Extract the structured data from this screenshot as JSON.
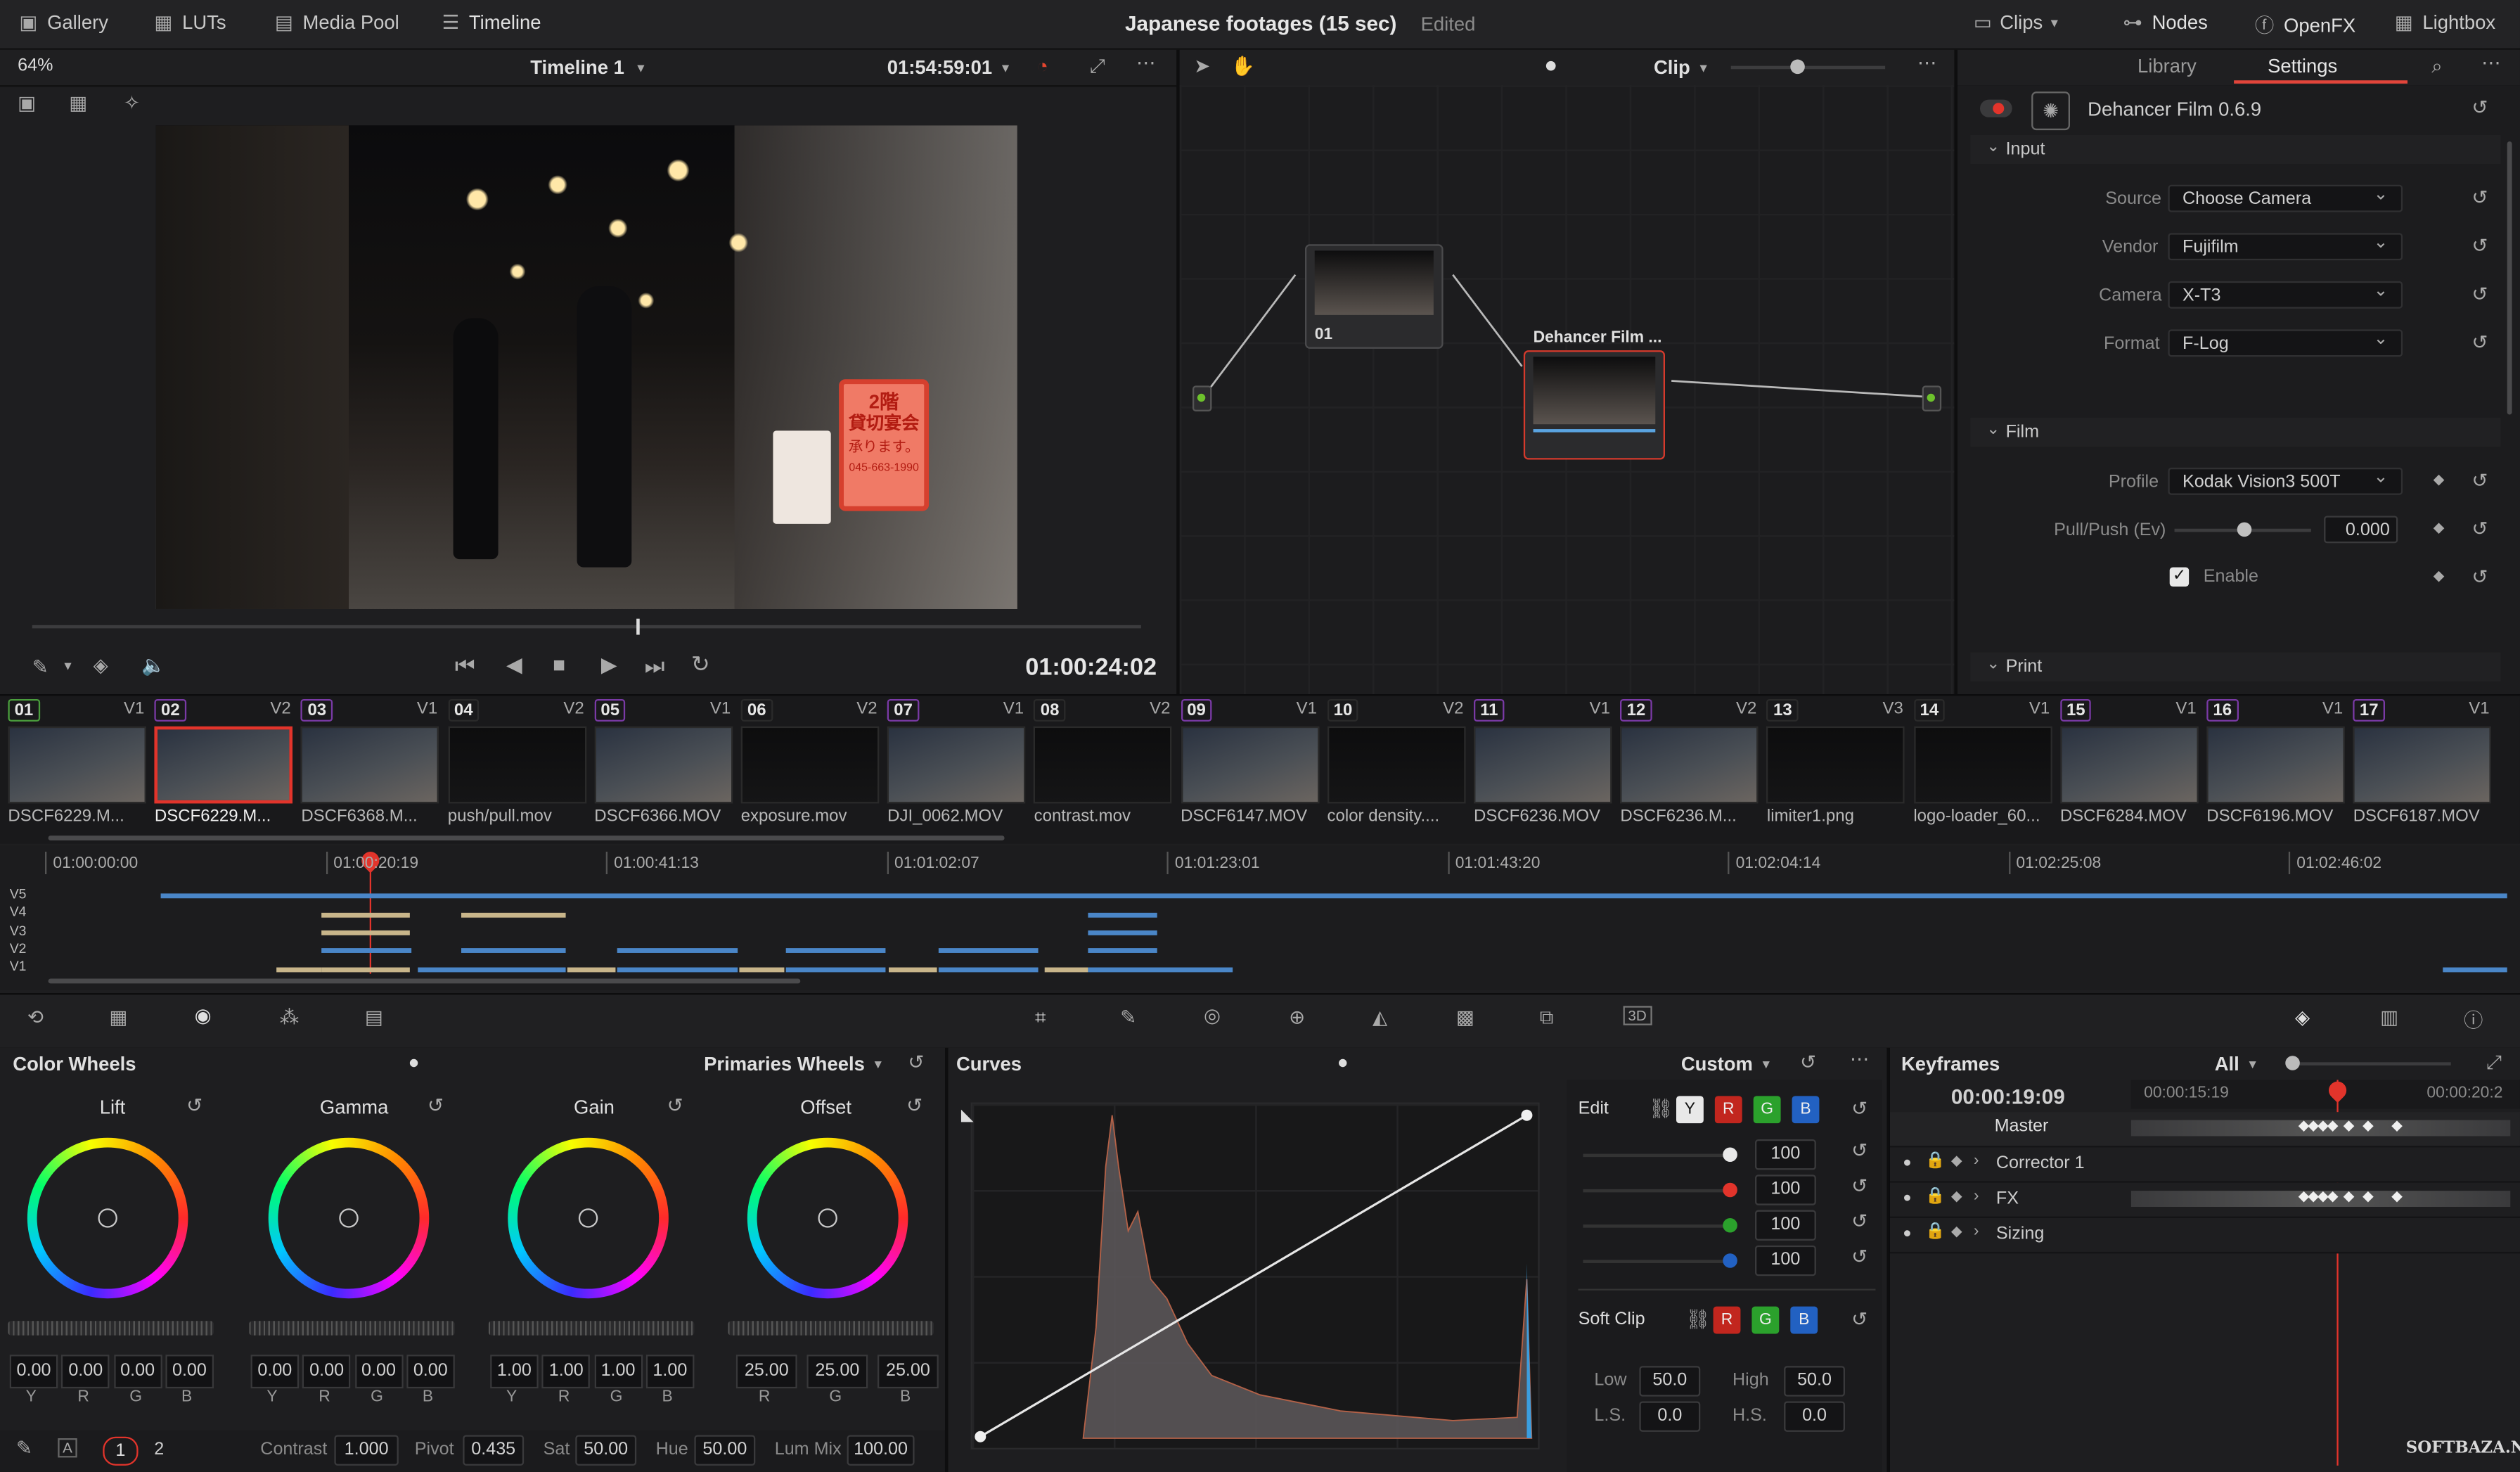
{
  "topbar": {
    "gallery": "Gallery",
    "luts": "LUTs",
    "media_pool": "Media Pool",
    "timeline": "Timeline",
    "title": "Japanese footages (15 sec)",
    "status": "Edited",
    "clips": "Clips",
    "nodes": "Nodes",
    "openfx": "OpenFX",
    "lightbox": "Lightbox"
  },
  "viewer": {
    "zoom": "64%",
    "timeline_name": "Timeline 1",
    "source_tc": "01:54:59:01",
    "timecode": "01:00:24:02",
    "sign_line1": "2階",
    "sign_line2": "貸切宴会",
    "sign_line3": "承ります。",
    "sign_phone": "045-663-1990"
  },
  "node_editor": {
    "mode": "Clip",
    "node1_label": "01",
    "node2_label": "Dehancer Film ..."
  },
  "settings": {
    "tab_library": "Library",
    "tab_settings": "Settings",
    "plugin": "Dehancer Film 0.6.9",
    "input_header": "Input",
    "source_label": "Source",
    "source_value": "Choose Camera",
    "vendor_label": "Vendor",
    "vendor_value": "Fujifilm",
    "camera_label": "Camera",
    "camera_value": "X-T3",
    "format_label": "Format",
    "format_value": "F-Log",
    "film_header": "Film",
    "profile_label": "Profile",
    "profile_value": "Kodak Vision3 500T",
    "pullpush_label": "Pull/Push (Ev)",
    "pullpush_value": "0.000",
    "enable_label": "Enable",
    "print_header": "Print"
  },
  "clips": [
    {
      "num": "01",
      "track": "V1",
      "name": "DSCF6229.M...",
      "color": "#4a9e3d"
    },
    {
      "num": "02",
      "track": "V2",
      "name": "DSCF6229.M...",
      "color": "#7a3aa6"
    },
    {
      "num": "03",
      "track": "V1",
      "name": "DSCF6368.M...",
      "color": "#7a3aa6"
    },
    {
      "num": "04",
      "track": "V2",
      "name": "push/pull.mov",
      "color": "#2a2a2a"
    },
    {
      "num": "05",
      "track": "V1",
      "name": "DSCF6366.MOV",
      "color": "#7a3aa6"
    },
    {
      "num": "06",
      "track": "V2",
      "name": "exposure.mov",
      "color": "#2a2a2a"
    },
    {
      "num": "07",
      "track": "V1",
      "name": "DJI_0062.MOV",
      "color": "#7a3aa6"
    },
    {
      "num": "08",
      "track": "V2",
      "name": "contrast.mov",
      "color": "#2a2a2a"
    },
    {
      "num": "09",
      "track": "V1",
      "name": "DSCF6147.MOV",
      "color": "#7a3aa6"
    },
    {
      "num": "10",
      "track": "V2",
      "name": "color density....",
      "color": "#2a2a2a"
    },
    {
      "num": "11",
      "track": "V1",
      "name": "DSCF6236.MOV",
      "color": "#7a3aa6"
    },
    {
      "num": "12",
      "track": "V2",
      "name": "DSCF6236.M...",
      "color": "#7a3aa6"
    },
    {
      "num": "13",
      "track": "V3",
      "name": "limiter1.png",
      "color": "#2a2a2a"
    },
    {
      "num": "14",
      "track": "V1",
      "name": "logo-loader_60...",
      "color": "#2a2a2a"
    },
    {
      "num": "15",
      "track": "V1",
      "name": "DSCF6284.MOV",
      "color": "#7a3aa6"
    },
    {
      "num": "16",
      "track": "V1",
      "name": "DSCF6196.MOV",
      "color": "#7a3aa6"
    },
    {
      "num": "17",
      "track": "V1",
      "name": "DSCF6187.MOV",
      "color": "#7a3aa6"
    }
  ],
  "mini_timeline": {
    "ticks": [
      "01:00:00:00",
      "01:00:20:19",
      "01:00:41:13",
      "01:01:02:07",
      "01:01:23:01",
      "01:01:43:20",
      "01:02:04:14",
      "01:02:25:08",
      "01:02:46:02"
    ],
    "tracks": [
      "V5",
      "V4",
      "V3",
      "V2",
      "V1"
    ]
  },
  "color_wheels": {
    "title": "Color Wheels",
    "mode": "Primaries Wheels",
    "wheels": [
      {
        "name": "Lift",
        "values": [
          "0.00",
          "0.00",
          "0.00",
          "0.00"
        ],
        "labels": [
          "Y",
          "R",
          "G",
          "B"
        ]
      },
      {
        "name": "Gamma",
        "values": [
          "0.00",
          "0.00",
          "0.00",
          "0.00"
        ],
        "labels": [
          "Y",
          "R",
          "G",
          "B"
        ]
      },
      {
        "name": "Gain",
        "values": [
          "1.00",
          "1.00",
          "1.00",
          "1.00"
        ],
        "labels": [
          "Y",
          "R",
          "G",
          "B"
        ]
      },
      {
        "name": "Offset",
        "values": [
          "25.00",
          "25.00",
          "25.00"
        ],
        "labels": [
          "R",
          "G",
          "B"
        ]
      }
    ],
    "bottom": {
      "page1": "1",
      "page2": "2",
      "contrast_label": "Contrast",
      "contrast": "1.000",
      "pivot_label": "Pivot",
      "pivot": "0.435",
      "sat_label": "Sat",
      "sat": "50.00",
      "hue_label": "Hue",
      "hue": "50.00",
      "lummix_label": "Lum Mix",
      "lummix": "100.00"
    }
  },
  "curves": {
    "title": "Curves",
    "mode": "Custom",
    "edit_label": "Edit",
    "channels": [
      "Y",
      "R",
      "G",
      "B"
    ],
    "values": [
      "100",
      "100",
      "100",
      "100"
    ],
    "softclip_label": "Soft Clip",
    "low_label": "Low",
    "low": "50.0",
    "high_label": "High",
    "high": "50.0",
    "ls_label": "L.S.",
    "ls": "0.0",
    "hs_label": "H.S.",
    "hs": "0.0"
  },
  "keyframes": {
    "title": "Keyframes",
    "filter": "All",
    "current": "00:00:19:09",
    "tc1": "00:00:15:19",
    "tc2": "00:00:20:2",
    "rows": [
      "Master",
      "Corrector 1",
      "FX",
      "Sizing"
    ]
  },
  "watermark": "SOFTBAZA.NET",
  "colors": {
    "accent_red": "#e0342b",
    "track_blue": "#4a86c8",
    "track_tan": "#c8b58a",
    "selected_tab": "#e2453b"
  }
}
